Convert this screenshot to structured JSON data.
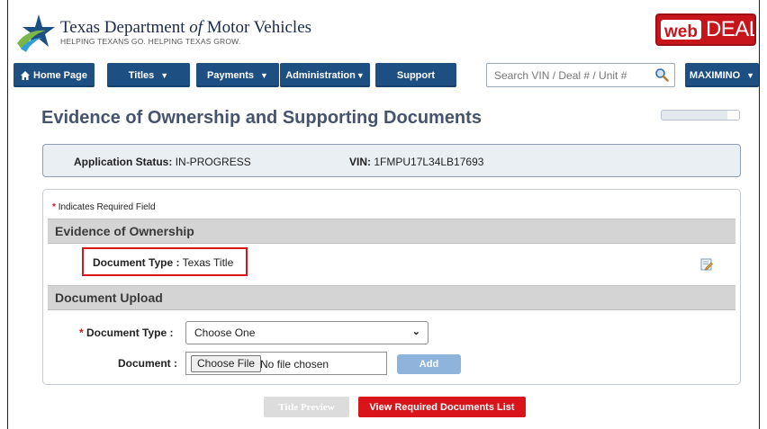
{
  "header": {
    "org_name_part1": "Texas Department ",
    "org_name_italic": "of",
    "org_name_part2": " Motor Vehicles",
    "tagline": "HELPING TEXANS GO. HELPING TEXAS GROW.",
    "brand_web": "web",
    "brand_dealer": "DEALER"
  },
  "nav": {
    "home": "Home Page",
    "home_icon": "home-icon",
    "titles": "Titles",
    "payments": "Payments",
    "administration": "Administration",
    "support": "Support",
    "search_placeholder": "Search VIN / Deal # / Unit #",
    "user": "MAXIMINO",
    "caret": "▼"
  },
  "page": {
    "title": "Evidence of Ownership and Supporting Documents",
    "progress_fraction": 0.85
  },
  "status": {
    "app_label": "Application Status:",
    "app_value": "IN-PROGRESS",
    "vin_label": "VIN:",
    "vin_value": "1FMPU17L34LB17693"
  },
  "form": {
    "required_star": "*",
    "required_note": "Indicates Required Field",
    "section_ownership": "Evidence of Ownership",
    "doc_type_label": "Document Type :",
    "doc_type_value": "Texas Title",
    "section_upload": "Document Upload",
    "upload_doc_type_label": "Document Type :",
    "upload_doc_type_selected": "Choose One",
    "document_label": "Document :",
    "choose_file": "Choose File",
    "no_file": "No file chosen",
    "add": "Add"
  },
  "actions": {
    "title_preview": "Title Preview",
    "view_required": "View Required Documents List"
  },
  "colors": {
    "nav_blue": "#1d4f83",
    "accent_red": "#d9141b",
    "title_slate": "#46546b"
  }
}
